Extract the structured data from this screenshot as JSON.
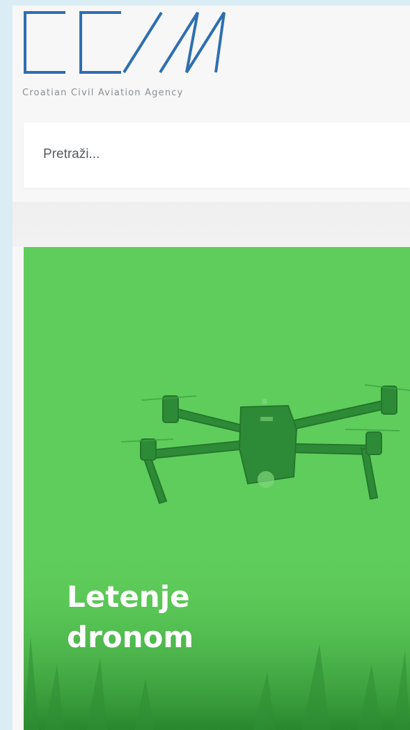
{
  "header": {
    "logo_icon": "ccaa-logo-mark",
    "tagline": "Croatian Civil Aviation Agency",
    "brand_color": "#2e6fb0"
  },
  "search": {
    "placeholder": "Pretraži..."
  },
  "hero": {
    "title_line1": "Letenje",
    "title_line2": "dronom",
    "overlay_color": "#5fcd5b",
    "image_icon": "drone-icon"
  }
}
